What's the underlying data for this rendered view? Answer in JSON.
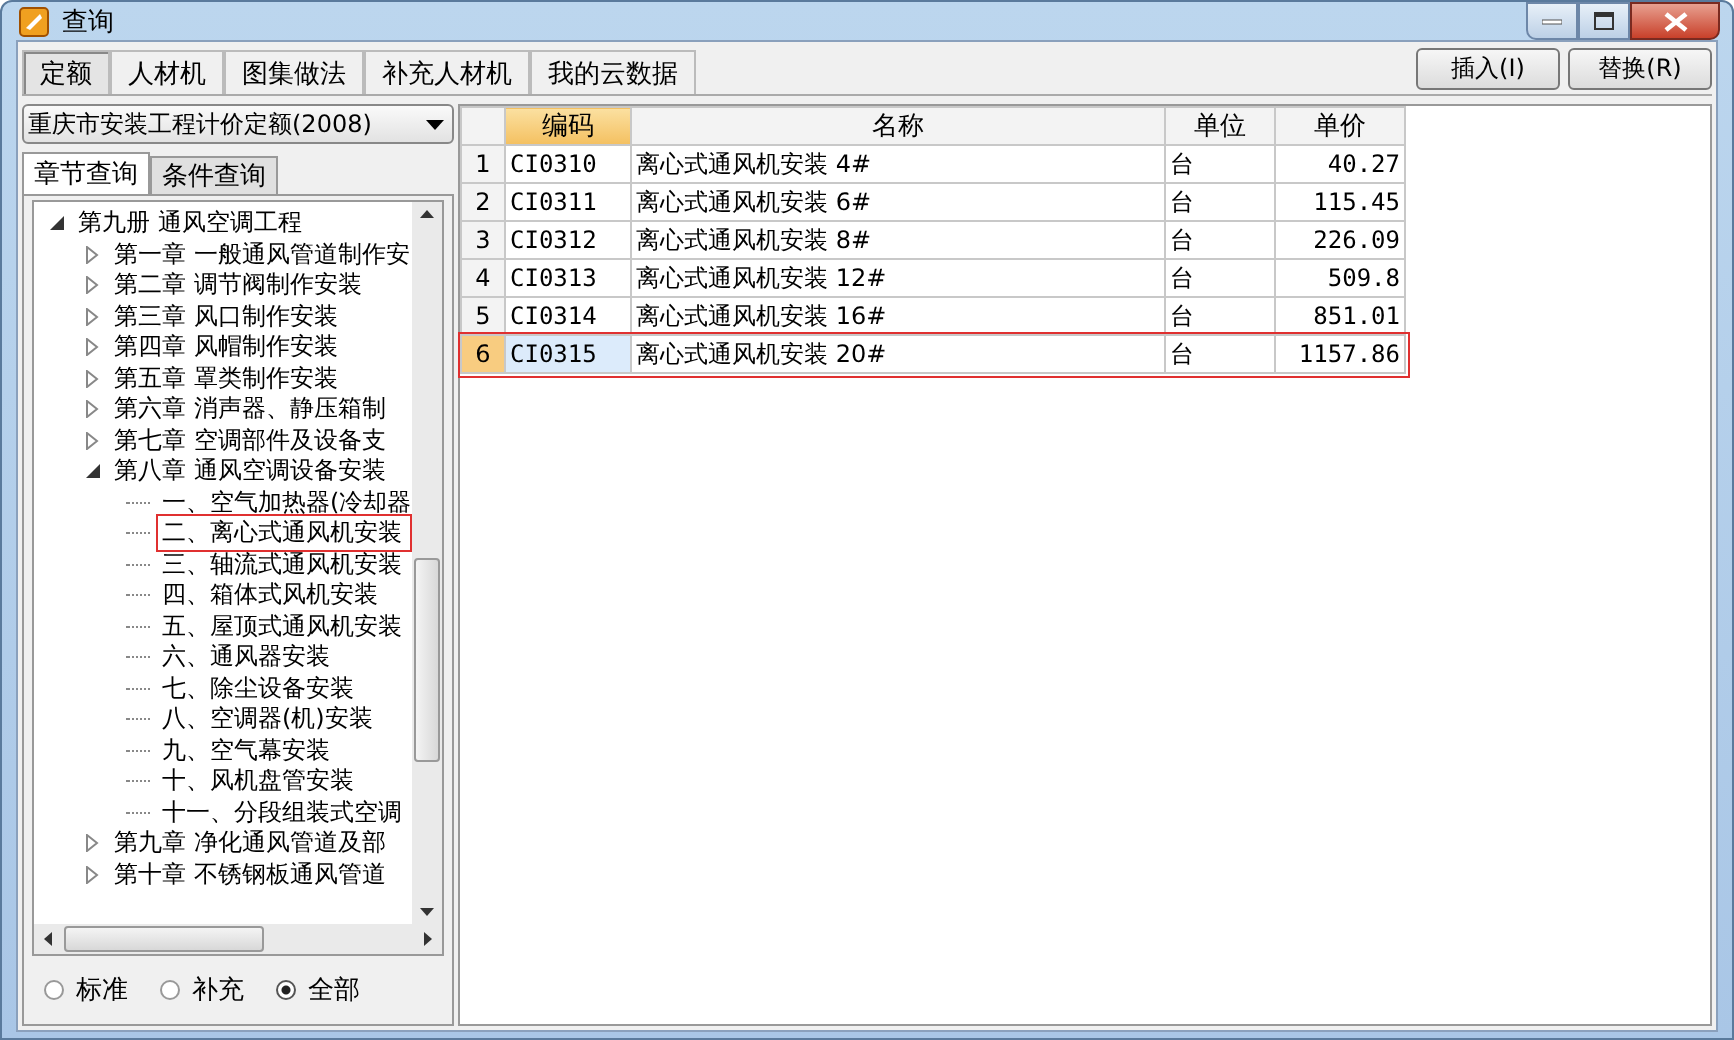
{
  "window": {
    "title": "查询"
  },
  "tabs": [
    {
      "label": "定额",
      "selected": true
    },
    {
      "label": "人材机",
      "selected": false
    },
    {
      "label": "图集做法",
      "selected": false
    },
    {
      "label": "补充人材机",
      "selected": false
    },
    {
      "label": "我的云数据",
      "selected": false
    }
  ],
  "buttons": [
    "插入(I)",
    "替换(R)"
  ],
  "library": {
    "value": "重庆市安装工程计价定额(2008)"
  },
  "subtabs": [
    {
      "label": "章节查询",
      "selected": true
    },
    {
      "label": "条件查询",
      "selected": false
    }
  ],
  "tree": [
    {
      "label": "第九册 通风空调工程",
      "kind": "branch",
      "expanded": true,
      "selected": false,
      "children": [
        {
          "label": "第一章 一般通风管道制作安",
          "kind": "branch",
          "expanded": false,
          "selected": false
        },
        {
          "label": "第二章 调节阀制作安装",
          "kind": "branch",
          "expanded": false,
          "selected": false
        },
        {
          "label": "第三章 风口制作安装",
          "kind": "branch",
          "expanded": false,
          "selected": false
        },
        {
          "label": "第四章 风帽制作安装",
          "kind": "branch",
          "expanded": false,
          "selected": false
        },
        {
          "label": "第五章 罩类制作安装",
          "kind": "branch",
          "expanded": false,
          "selected": false
        },
        {
          "label": "第六章 消声器、静压箱制",
          "kind": "branch",
          "expanded": false,
          "selected": false
        },
        {
          "label": "第七章 空调部件及设备支",
          "kind": "branch",
          "expanded": false,
          "selected": false
        },
        {
          "label": "第八章 通风空调设备安装",
          "kind": "branch",
          "expanded": true,
          "selected": false,
          "children": [
            {
              "label": "一、空气加热器(冷却器",
              "kind": "leaf",
              "selected": false
            },
            {
              "label": "二、离心式通风机安装",
              "kind": "leaf",
              "selected": true
            },
            {
              "label": "三、轴流式通风机安装",
              "kind": "leaf",
              "selected": false
            },
            {
              "label": "四、箱体式风机安装",
              "kind": "leaf",
              "selected": false
            },
            {
              "label": "五、屋顶式通风机安装",
              "kind": "leaf",
              "selected": false
            },
            {
              "label": "六、通风器安装",
              "kind": "leaf",
              "selected": false
            },
            {
              "label": "七、除尘设备安装",
              "kind": "leaf",
              "selected": false
            },
            {
              "label": "八、空调器(机)安装",
              "kind": "leaf",
              "selected": false
            },
            {
              "label": "九、空气幕安装",
              "kind": "leaf",
              "selected": false
            },
            {
              "label": "十、风机盘管安装",
              "kind": "leaf",
              "selected": false
            },
            {
              "label": "十一、分段组装式空调",
              "kind": "leaf",
              "selected": false
            }
          ]
        },
        {
          "label": "第九章 净化通风管道及部",
          "kind": "branch",
          "expanded": false,
          "selected": false
        },
        {
          "label": "第十章 不锈钢板通风管道",
          "kind": "branch",
          "expanded": false,
          "selected": false
        }
      ]
    }
  ],
  "filters": [
    {
      "label": "标准",
      "selected": false
    },
    {
      "label": "补充",
      "selected": false
    },
    {
      "label": "全部",
      "selected": true
    }
  ],
  "table": {
    "columns": [
      {
        "label": "编码",
        "selected": true
      },
      {
        "label": "名称",
        "selected": false
      },
      {
        "label": "单位",
        "selected": false
      },
      {
        "label": "单价",
        "selected": false
      }
    ],
    "rows": [
      {
        "index": "1",
        "cells": [
          "CI0310",
          "离心式通风机安装 4#",
          "台",
          "40.27"
        ],
        "selected": false
      },
      {
        "index": "2",
        "cells": [
          "CI0311",
          "离心式通风机安装 6#",
          "台",
          "115.45"
        ],
        "selected": false
      },
      {
        "index": "3",
        "cells": [
          "CI0312",
          "离心式通风机安装 8#",
          "台",
          "226.09"
        ],
        "selected": false
      },
      {
        "index": "4",
        "cells": [
          "CI0313",
          "离心式通风机安装 12#",
          "台",
          "509.8"
        ],
        "selected": false
      },
      {
        "index": "5",
        "cells": [
          "CI0314",
          "离心式通风机安装 16#",
          "台",
          "851.01"
        ],
        "selected": false
      },
      {
        "index": "6",
        "cells": [
          "CI0315",
          "离心式通风机安装 20#",
          "台",
          "1157.86"
        ],
        "selected": true
      }
    ]
  }
}
